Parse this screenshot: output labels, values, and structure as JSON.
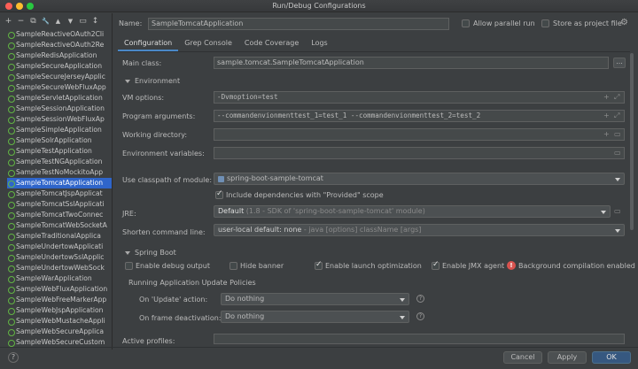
{
  "window": {
    "title": "Run/Debug Configurations"
  },
  "colors": {
    "accent": "#2f65ca",
    "error": "#d9534f",
    "primary_button": "#365880"
  },
  "toolbar": {
    "icons": [
      "add-icon",
      "remove-icon",
      "copy-icon",
      "wrench-icon",
      "move-up-icon",
      "move-down-icon",
      "folder-icon",
      "sort-icon"
    ],
    "glyphs": [
      "+",
      "−",
      "⧉",
      "🔧",
      "▲",
      "▼",
      "▭",
      "↕"
    ]
  },
  "tree": {
    "items": [
      "SampleReactiveOAuth2Cli",
      "SampleReactiveOAuth2Re",
      "SampleRedisApplication",
      "SampleSecureApplication",
      "SampleSecureJerseyApplic",
      "SampleSecureWebFluxApp",
      "SampleServletApplication",
      "SampleSessionApplication",
      "SampleSessionWebFluxAp",
      "SampleSimpleApplication",
      "SampleSolrApplication",
      "SampleTestApplication",
      "SampleTestNGApplication",
      "SampleTestNoMockitoApp",
      "SampleTomcatApplication",
      "SampleTomcatJspApplicat",
      "SampleTomcatSslApplicati",
      "SampleTomcatTwoConnec",
      "SampleTomcatWebSocketA",
      "SampleTraditionalApplica",
      "SampleUndertowApplicati",
      "SampleUndertowSslApplic",
      "SampleUndertowWebSock",
      "SampleWarApplication",
      "SampleWebFluxApplication",
      "SampleWebFreeMarkerApp",
      "SampleWebJspApplication",
      "SampleWebMustacheAppli",
      "SampleWebSecureApplica",
      "SampleWebSecureCustom"
    ],
    "selected_index": 14
  },
  "header": {
    "name_label": "Name:",
    "name_value": "SampleTomcatApplication",
    "allow_parallel_run": "Allow parallel run",
    "store_as_project_file": "Store as project file",
    "gear_glyph": "⚙"
  },
  "tabs": [
    "Configuration",
    "Grep Console",
    "Code Coverage",
    "Logs"
  ],
  "config": {
    "main_class_label": "Main class:",
    "main_class_value": "sample.tomcat.SampleTomcatApplication",
    "browse_glyph": "...",
    "environment_section": "Environment",
    "vm_options_label": "VM options:",
    "vm_options_value": "-Dvmoption=test",
    "program_args_label": "Program arguments:",
    "program_args_value": "--commandenvionmenttest_1=test_1 --commandenvionmenttest_2=test_2",
    "working_dir_label": "Working directory:",
    "working_dir_value": "",
    "env_vars_label": "Environment variables:",
    "env_vars_value": "",
    "expand_glyph": "+",
    "resize_glyph": "⤢",
    "folder_glyph": "▭",
    "classpath_label": "Use classpath of module:",
    "classpath_value": "spring-boot-sample-tomcat",
    "include_provided": "Include dependencies with \"Provided\" scope",
    "jre_label": "JRE:",
    "jre_value_bold": "Default",
    "jre_value_rest": " (1.8 - SDK of 'spring-boot-sample-tomcat' module)",
    "shorten_label": "Shorten command line:",
    "shorten_value_main": "user-local default: none",
    "shorten_value_rest": " - java [options] className [args]"
  },
  "spring_boot": {
    "section": "Spring Boot",
    "enable_debug_output": "Enable debug output",
    "hide_banner": "Hide banner",
    "enable_launch_optimization": "Enable launch optimization",
    "enable_jmx_agent": "Enable JMX agent",
    "background_compilation": "Background compilation enabled",
    "policies_title": "Running Application Update Policies",
    "on_update_label": "On 'Update' action:",
    "on_update_value": "Do nothing",
    "on_frame_label": "On frame deactivation:",
    "on_frame_value": "Do nothing",
    "active_profiles_label": "Active profiles:",
    "active_profiles_value": "",
    "question_glyph": "?",
    "error_glyph": "!"
  },
  "footer": {
    "help_glyph": "?",
    "cancel": "Cancel",
    "apply": "Apply",
    "ok": "OK"
  }
}
